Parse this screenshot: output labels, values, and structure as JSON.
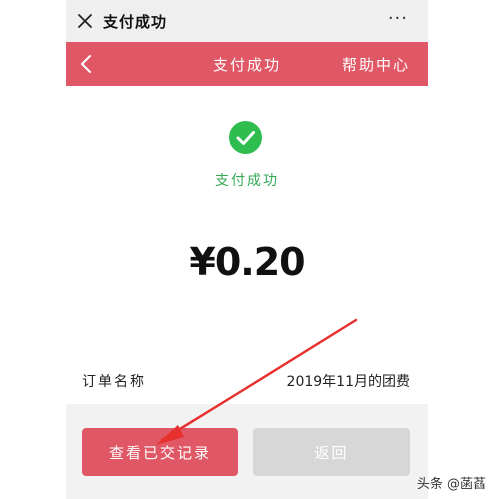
{
  "window": {
    "title": "支付成功",
    "more_label": "···"
  },
  "header": {
    "title": "支付成功",
    "help_label": "帮助中心"
  },
  "status": {
    "message": "支付成功",
    "icon": "check-circle-icon",
    "color": "#34a853"
  },
  "payment": {
    "amount": "¥0.20"
  },
  "order": {
    "label": "订单名称",
    "value": "2019年11月的团费"
  },
  "actions": {
    "view_records_label": "查看已交记录",
    "return_label": "返回"
  },
  "watermark": {
    "text": "头条 @菡萏"
  },
  "colors": {
    "accent": "#e05766",
    "disabled": "#d7d7d7",
    "annotation_arrow": "#e8312e"
  }
}
